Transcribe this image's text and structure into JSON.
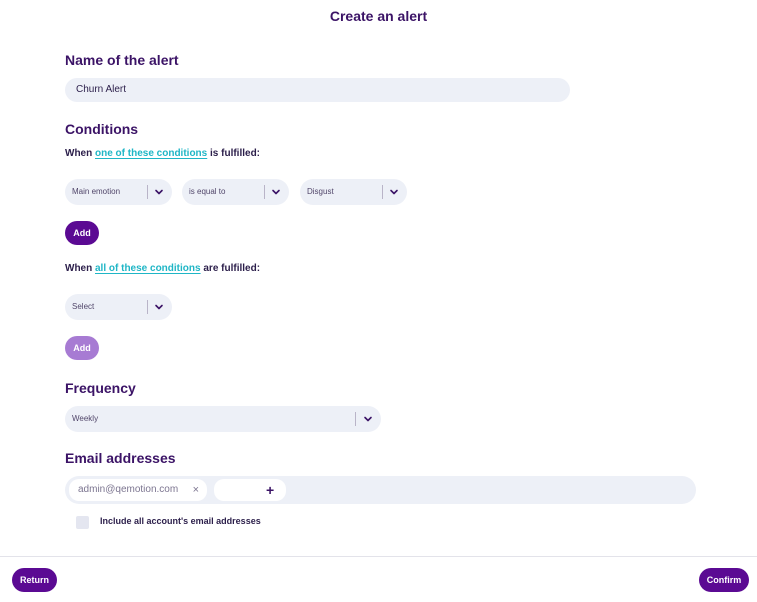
{
  "page": {
    "title": "Create an alert"
  },
  "name_section": {
    "heading": "Name of the alert",
    "value": "Churn Alert"
  },
  "conditions": {
    "heading": "Conditions",
    "any_prefix": "When",
    "any_link": "one of these conditions",
    "any_suffix": "is fulfilled:",
    "any_row": {
      "field": "Main emotion",
      "operator": "is equal to",
      "value": "Disgust"
    },
    "add_label_1": "Add",
    "all_prefix": "When",
    "all_link": "all of these conditions",
    "all_suffix": "are fulfilled:",
    "all_row": {
      "field": "Select"
    },
    "add_label_2": "Add"
  },
  "frequency": {
    "heading": "Frequency",
    "value": "Weekly"
  },
  "email": {
    "heading": "Email addresses",
    "tags": [
      "admin@qemotion.com"
    ],
    "add_symbol": "+",
    "include_all_label": "Include all account's email addresses"
  },
  "footer": {
    "return_label": "Return",
    "confirm_label": "Confirm"
  },
  "colors": {
    "primary": "#5b0a93",
    "primary_light": "#a77bd3",
    "link": "#1fb6c6",
    "field_bg": "#edf0f7"
  }
}
